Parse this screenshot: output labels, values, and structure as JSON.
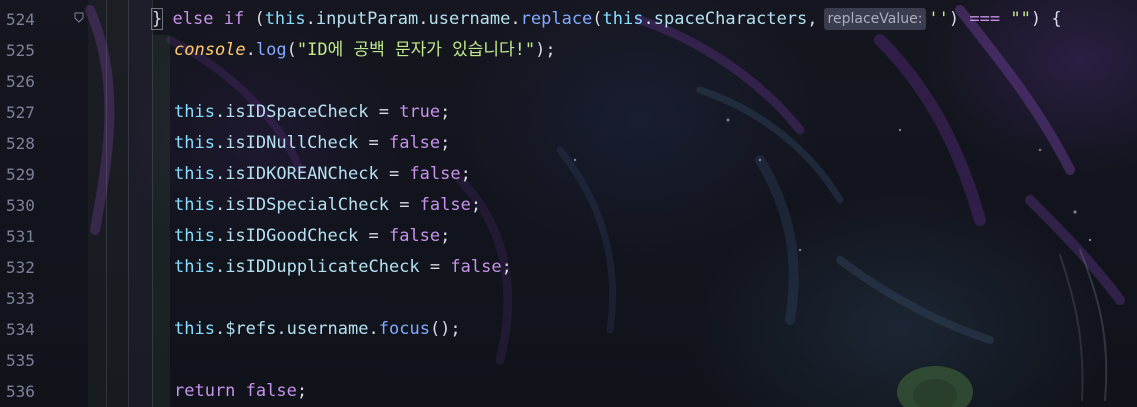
{
  "gutter": {
    "line_numbers": [
      "524",
      "525",
      "526",
      "527",
      "528",
      "529",
      "530",
      "531",
      "532",
      "533",
      "534",
      "535",
      "536"
    ]
  },
  "code": {
    "l524": {
      "brace": "}",
      "else_kw": "else",
      "if_kw": "if",
      "open_paren": "(",
      "this": "this",
      "dot1": ".",
      "inputParam": "inputParam",
      "dot2": ".",
      "username": "username",
      "dot3": ".",
      "replace": "replace",
      "open_paren2": "(",
      "this2": "this",
      "dot4": ".",
      "spaceCharacters": "spaceCharacters",
      "comma": ",",
      "hint": "replaceValue:",
      "empty_str": "''",
      "close_paren": ")",
      "strict_eq": "===",
      "empty_str2": "\"\"",
      "close_paren2": ")",
      "open_brace": "{"
    },
    "l525": {
      "console": "console",
      "dot": ".",
      "log": "log",
      "open_paren": "(",
      "message": "\"ID에 공백 문자가 있습니다!\"",
      "close": ");"
    },
    "l527": {
      "this": "this",
      "prop": ".isIDSpaceCheck",
      "eq": " = ",
      "val": "true",
      "semi": ";"
    },
    "l528": {
      "this": "this",
      "prop": ".isIDNullCheck",
      "eq": " = ",
      "val": "false",
      "semi": ";"
    },
    "l529": {
      "this": "this",
      "prop": ".isIDKOREANCheck",
      "eq": " = ",
      "val": "false",
      "semi": ";"
    },
    "l530": {
      "this": "this",
      "prop": ".isIDSpecialCheck",
      "eq": " = ",
      "val": "false",
      "semi": ";"
    },
    "l531": {
      "this": "this",
      "prop": ".isIDGoodCheck",
      "eq": " = ",
      "val": "false",
      "semi": ";"
    },
    "l532": {
      "this": "this",
      "prop": ".isIDDupplicateCheck",
      "eq": " = ",
      "val": "false",
      "semi": ";"
    },
    "l534": {
      "this": "this",
      "refs": ".$refs",
      "username": ".username",
      "dot": ".",
      "focus": "focus",
      "call": "();"
    },
    "l536": {
      "return_kw": "return",
      "val": " false",
      "semi": ";"
    }
  },
  "colors": {
    "keyword": "#c792ea",
    "this": "#89ddff",
    "function": "#82aaff",
    "string": "#c3e88d",
    "console": "#ffcb6b",
    "line_number": "#7b8196"
  },
  "icons": {
    "fold": "fold-marker-icon"
  }
}
